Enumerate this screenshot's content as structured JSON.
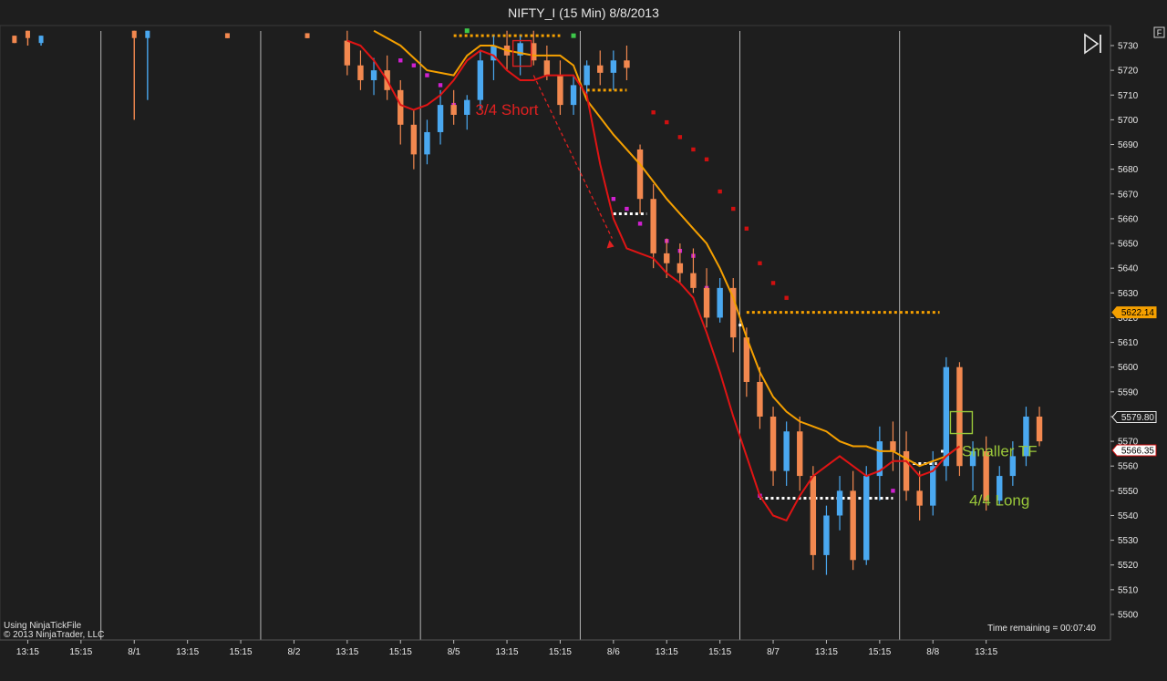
{
  "window": {
    "title": "NIFTY_I (15 Min)  8/8/2013",
    "corner_badge": "F"
  },
  "footer": {
    "credit_line1": "Using NinjaTickFile",
    "credit_line2": "© 2013 NinjaTrader, LLC",
    "time_remaining": "Time remaining = 00:07:40"
  },
  "icons": {
    "play_forward": "play-forward-icon"
  },
  "colors": {
    "background": "#1e1e1e",
    "up_candle": "#4aa8f0",
    "down_candle": "#f2884f",
    "fast_ma": "#e01414",
    "slow_ma": "#f5a000",
    "annotation_short": "#e02020",
    "annotation_long": "#9ac83a",
    "marker_white": "#ffffff",
    "marker_magenta": "#d020d0",
    "marker_red": "#d01010",
    "marker_orange": "#f5a000"
  },
  "chart_data": {
    "type": "candlestick",
    "title": "NIFTY_I (15 Min)  8/8/2013",
    "ylim": [
      5495,
      5735
    ],
    "y_ticks": [
      5500,
      5510,
      5520,
      5530,
      5540,
      5550,
      5560,
      5570,
      5580,
      5590,
      5600,
      5610,
      5620,
      5630,
      5640,
      5650,
      5660,
      5670,
      5680,
      5690,
      5700,
      5710,
      5720,
      5730
    ],
    "x_ticks": [
      {
        "i": 2,
        "label": "13:15"
      },
      {
        "i": 6,
        "label": "15:15"
      },
      {
        "i": 10,
        "label": "8/1"
      },
      {
        "i": 14,
        "label": "13:15"
      },
      {
        "i": 18,
        "label": "15:15"
      },
      {
        "i": 22,
        "label": "8/2"
      },
      {
        "i": 26,
        "label": "13:15"
      },
      {
        "i": 30,
        "label": "15:15"
      },
      {
        "i": 34,
        "label": "8/5"
      },
      {
        "i": 38,
        "label": "13:15"
      },
      {
        "i": 42,
        "label": "15:15"
      },
      {
        "i": 46,
        "label": "8/6"
      },
      {
        "i": 50,
        "label": "13:15"
      },
      {
        "i": 54,
        "label": "15:15"
      },
      {
        "i": 58,
        "label": "8/7"
      },
      {
        "i": 62,
        "label": "13:15"
      },
      {
        "i": 66,
        "label": "15:15"
      },
      {
        "i": 70,
        "label": "8/8"
      },
      {
        "i": 74,
        "label": "13:15"
      }
    ],
    "session_separators": [
      7.5,
      19.5,
      31.5,
      43.5,
      55.5,
      67.5
    ],
    "bars_start_index": 26,
    "bars": [
      [
        5732,
        5736,
        5718,
        5722
      ],
      [
        5722,
        5728,
        5712,
        5716
      ],
      [
        5716,
        5725,
        5710,
        5720
      ],
      [
        5720,
        5726,
        5708,
        5712
      ],
      [
        5712,
        5716,
        5690,
        5698
      ],
      [
        5698,
        5704,
        5680,
        5686
      ],
      [
        5686,
        5700,
        5682,
        5695
      ],
      [
        5695,
        5712,
        5690,
        5706
      ],
      [
        5706,
        5712,
        5698,
        5702
      ],
      [
        5702,
        5710,
        5696,
        5708
      ],
      [
        5708,
        5728,
        5704,
        5724
      ],
      [
        5724,
        5734,
        5716,
        5730
      ],
      [
        5730,
        5736,
        5720,
        5726
      ],
      [
        5726,
        5734,
        5718,
        5731
      ],
      [
        5731,
        5736,
        5722,
        5724
      ],
      [
        5724,
        5730,
        5716,
        5718
      ],
      [
        5718,
        5724,
        5702,
        5706
      ],
      [
        5706,
        5718,
        5702,
        5714
      ],
      [
        5714,
        5724,
        5710,
        5722
      ],
      [
        5722,
        5728,
        5714,
        5719
      ],
      [
        5719,
        5728,
        5712,
        5724
      ],
      [
        5724,
        5730,
        5716,
        5721
      ],
      [
        5688,
        5690,
        5662,
        5668
      ],
      [
        5668,
        5674,
        5640,
        5646
      ],
      [
        5646,
        5652,
        5636,
        5642
      ],
      [
        5642,
        5650,
        5634,
        5638
      ],
      [
        5638,
        5648,
        5630,
        5632
      ],
      [
        5632,
        5640,
        5616,
        5620
      ],
      [
        5620,
        5636,
        5618,
        5632
      ],
      [
        5632,
        5636,
        5606,
        5612
      ],
      [
        5612,
        5616,
        5588,
        5594
      ],
      [
        5594,
        5600,
        5575,
        5580
      ],
      [
        5580,
        5584,
        5552,
        5558
      ],
      [
        5558,
        5578,
        5552,
        5574
      ],
      [
        5574,
        5580,
        5550,
        5556
      ],
      [
        5556,
        5560,
        5518,
        5524
      ],
      [
        5524,
        5544,
        5516,
        5540
      ],
      [
        5540,
        5556,
        5534,
        5550
      ],
      [
        5550,
        5558,
        5518,
        5522
      ],
      [
        5522,
        5560,
        5520,
        5556
      ],
      [
        5556,
        5576,
        5546,
        5570
      ],
      [
        5570,
        5578,
        5558,
        5566
      ],
      [
        5566,
        5574,
        5546,
        5550
      ],
      [
        5550,
        5558,
        5538,
        5544
      ],
      [
        5544,
        5566,
        5540,
        5560
      ],
      [
        5560,
        5604,
        5554,
        5600
      ],
      [
        5600,
        5602,
        5556,
        5560
      ],
      [
        5560,
        5570,
        5550,
        5566
      ],
      [
        5566,
        5572,
        5542,
        5546
      ],
      [
        5546,
        5560,
        5544,
        5556
      ],
      [
        5556,
        5570,
        5552,
        5564
      ],
      [
        5564,
        5584,
        5560,
        5580
      ],
      [
        5580,
        5584,
        5568,
        5570
      ]
    ],
    "early_ticks": [
      {
        "i": 1,
        "high": 5734,
        "low": 5731,
        "dir": "down"
      },
      {
        "i": 2,
        "high": 5736,
        "low": 5730,
        "dir": "down"
      },
      {
        "i": 3,
        "high": 5734,
        "low": 5730,
        "dir": "up"
      },
      {
        "i": 10,
        "high": 5736,
        "low": 5700,
        "dir": "down"
      },
      {
        "i": 11,
        "high": 5736,
        "low": 5708,
        "dir": "up"
      },
      {
        "i": 17,
        "high": 5735,
        "low": 5733,
        "dir": "down"
      },
      {
        "i": 23,
        "high": 5735,
        "low": 5733,
        "dir": "down"
      }
    ],
    "fast_ma": [
      [
        26,
        5732
      ],
      [
        27,
        5730
      ],
      [
        28,
        5724
      ],
      [
        29,
        5716
      ],
      [
        30,
        5706
      ],
      [
        31,
        5704
      ],
      [
        32,
        5706
      ],
      [
        33,
        5710
      ],
      [
        34,
        5716
      ],
      [
        35,
        5724
      ],
      [
        36,
        5728
      ],
      [
        37,
        5726
      ],
      [
        38,
        5720
      ],
      [
        39,
        5716
      ],
      [
        40,
        5716
      ],
      [
        41,
        5718
      ],
      [
        42,
        5718
      ],
      [
        43,
        5718
      ],
      [
        44,
        5710
      ],
      [
        45,
        5682
      ],
      [
        46,
        5660
      ],
      [
        47,
        5648
      ],
      [
        48,
        5646
      ],
      [
        49,
        5644
      ],
      [
        50,
        5638
      ],
      [
        51,
        5634
      ],
      [
        52,
        5628
      ],
      [
        53,
        5614
      ],
      [
        54,
        5598
      ],
      [
        55,
        5580
      ],
      [
        56,
        5564
      ],
      [
        57,
        5548
      ],
      [
        58,
        5540
      ],
      [
        59,
        5538
      ],
      [
        60,
        5548
      ],
      [
        61,
        5556
      ],
      [
        62,
        5560
      ],
      [
        63,
        5564
      ],
      [
        64,
        5560
      ],
      [
        65,
        5556
      ],
      [
        66,
        5558
      ],
      [
        67,
        5562
      ],
      [
        68,
        5562
      ],
      [
        69,
        5556
      ],
      [
        70,
        5558
      ],
      [
        71,
        5564
      ],
      [
        72,
        5568
      ]
    ],
    "slow_ma": [
      [
        28,
        5736
      ],
      [
        30,
        5730
      ],
      [
        32,
        5720
      ],
      [
        34,
        5718
      ],
      [
        35,
        5726
      ],
      [
        36,
        5730
      ],
      [
        37,
        5730
      ],
      [
        38,
        5728
      ],
      [
        40,
        5726
      ],
      [
        42,
        5726
      ],
      [
        43,
        5722
      ],
      [
        44,
        5708
      ],
      [
        46,
        5694
      ],
      [
        48,
        5682
      ],
      [
        50,
        5668
      ],
      [
        52,
        5656
      ],
      [
        53,
        5650
      ],
      [
        54,
        5640
      ],
      [
        55,
        5628
      ],
      [
        56,
        5612
      ],
      [
        57,
        5598
      ],
      [
        58,
        5588
      ],
      [
        59,
        5582
      ],
      [
        60,
        5578
      ],
      [
        61,
        5576
      ],
      [
        62,
        5574
      ],
      [
        63,
        5570
      ],
      [
        64,
        5568
      ],
      [
        65,
        5568
      ],
      [
        66,
        5566
      ],
      [
        67,
        5566
      ],
      [
        68,
        5563
      ],
      [
        69,
        5560
      ],
      [
        70,
        5562
      ],
      [
        71,
        5564
      ],
      [
        72,
        5568
      ]
    ],
    "support_resistance_levels": [
      {
        "y": 5734,
        "from": 34,
        "to": 42,
        "color": "orange"
      },
      {
        "y": 5712,
        "from": 44,
        "to": 47,
        "color": "orange"
      },
      {
        "y": 5662,
        "from": 46,
        "to": 48.5,
        "color": "white"
      },
      {
        "y": 5622.14,
        "from": 56,
        "to": 70.5,
        "color": "orange"
      },
      {
        "y": 5617,
        "from": 55,
        "to": 55.7,
        "color": "white"
      },
      {
        "y": 5547,
        "from": 57,
        "to": 67,
        "color": "white"
      },
      {
        "y": 5561,
        "from": 68.5,
        "to": 70.3,
        "color": "white"
      },
      {
        "y": 5566,
        "from": 70.6,
        "to": 71.3,
        "color": "white"
      }
    ],
    "current_price_label": "5622.14",
    "price_labels": [
      "5579.80",
      "5566.35"
    ],
    "annotations": [
      {
        "text": "3/4 Short",
        "color": "red"
      },
      {
        "text": "Smaller TF",
        "color": "green"
      },
      {
        "text": "4/4 Long",
        "color": "green"
      }
    ]
  }
}
